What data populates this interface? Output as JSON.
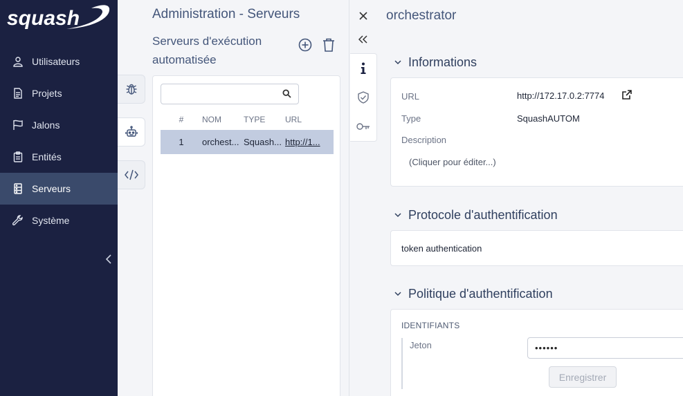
{
  "brand": {
    "logo_text": "squash"
  },
  "sidebar": {
    "items": [
      {
        "label": "Utilisateurs",
        "icon": "user-icon"
      },
      {
        "label": "Projets",
        "icon": "document-icon"
      },
      {
        "label": "Jalons",
        "icon": "flag-icon"
      },
      {
        "label": "Entités",
        "icon": "clipboard-icon"
      },
      {
        "label": "Serveurs",
        "icon": "server-icon",
        "active": true
      },
      {
        "label": "Système",
        "icon": "wrench-icon"
      }
    ],
    "collapse_icon": "chevron-left-icon"
  },
  "middle": {
    "title": "Administration - Serveurs",
    "subtitle": "Serveurs d'exécution automatisée",
    "search": {
      "value": "",
      "placeholder": ""
    },
    "columns": [
      "#",
      "NOM",
      "TYPE",
      "URL"
    ],
    "rows": [
      {
        "num": "1",
        "name": "orchest...",
        "type": "Squash...",
        "url": "http://1..."
      }
    ],
    "vtabs": [
      "bug-icon",
      "robot-icon",
      "code-icon"
    ]
  },
  "right": {
    "title": "orchestrator",
    "sections": {
      "informations": {
        "title": "Informations",
        "url_label": "URL",
        "url_value": "http://172.17.0.2:7774",
        "type_label": "Type",
        "type_value": "SquashAUTOM",
        "description_label": "Description",
        "description_placeholder": "(Cliquer pour éditer...)"
      },
      "protocol": {
        "title": "Protocole d'authentification",
        "value": "token authentication"
      },
      "policy": {
        "title": "Politique d'authentification",
        "caption": "IDENTIFIANTS",
        "token_label": "Jeton",
        "token_value": "••••••",
        "save_label": "Enregistrer"
      }
    }
  },
  "colors": {
    "sidebar_bg": "#1b2141",
    "sidebar_active": "#3a4a6b",
    "selected_row": "#c2cce0",
    "title": "#44567a"
  }
}
